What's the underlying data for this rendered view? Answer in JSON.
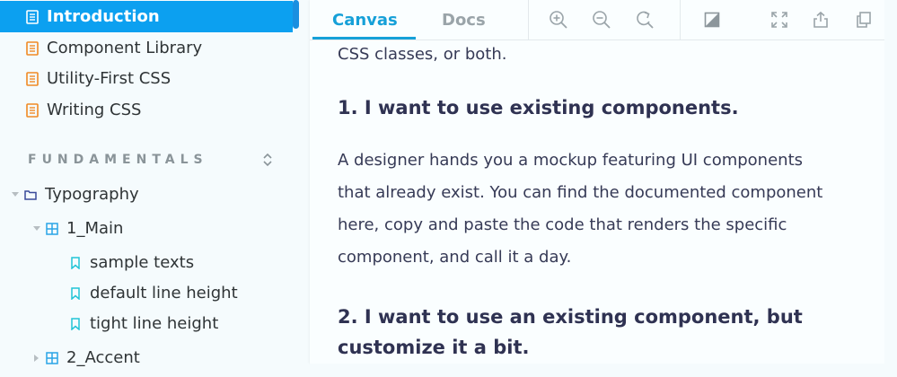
{
  "sidebar": {
    "top_items": [
      {
        "label": "Introduction",
        "icon": "document-icon",
        "active": true
      },
      {
        "label": "Component Library",
        "icon": "document-icon"
      },
      {
        "label": "Utility-First CSS",
        "icon": "document-icon"
      },
      {
        "label": "Writing CSS",
        "icon": "document-icon"
      }
    ],
    "section_title": "FUNDAMENTALS",
    "tree": {
      "typography": "Typography",
      "main": "1_Main",
      "stories": [
        "sample texts",
        "default line height",
        "tight line height"
      ],
      "accent": "2_Accent"
    }
  },
  "toolbar": {
    "tabs": [
      "Canvas",
      "Docs"
    ],
    "buttons": [
      "zoom-in-icon",
      "zoom-out-icon",
      "reset-zoom-icon",
      "background-icon",
      "fullscreen-icon",
      "share-icon",
      "copy-icon"
    ]
  },
  "content": {
    "intro_tail": "CSS classes, or both.",
    "heading1": "1. I want to use existing components.",
    "paragraph1_lines": [
      "A designer hands you a mockup featuring UI components",
      "that already exist. You can find the documented component",
      "here, copy and paste the code that renders the specific",
      "component, and call it a day."
    ],
    "heading2_lines": [
      "2. I want to use an existing component, but",
      "customize it a bit."
    ]
  },
  "colors": {
    "accent": "#16a0d8",
    "active_item_bg": "#0ca0f0",
    "doc_icon": "#f08a24",
    "story_icon": "#21c4d6",
    "tree_icon": "#2aa5e6"
  }
}
